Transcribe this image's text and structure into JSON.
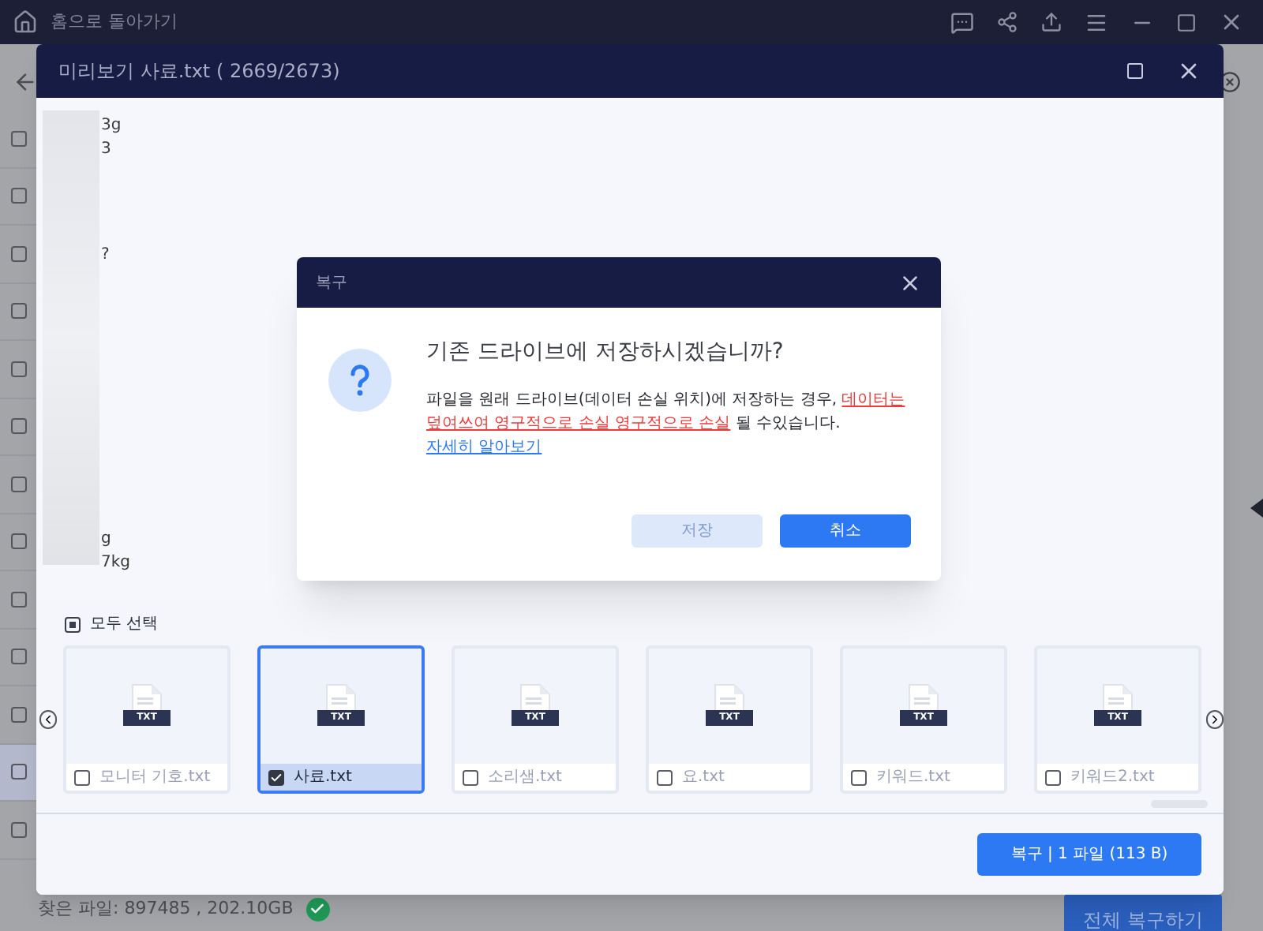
{
  "app_bar": {
    "title": "홈으로 돌아가기"
  },
  "file_list": {
    "rows": [
      {
        "checked": false,
        "selected": false
      },
      {
        "checked": false,
        "selected": false
      },
      {
        "checked": false,
        "selected": false
      },
      {
        "checked": false,
        "selected": false
      },
      {
        "checked": false,
        "selected": false
      },
      {
        "checked": false,
        "selected": false
      },
      {
        "checked": false,
        "selected": false
      },
      {
        "checked": false,
        "selected": false
      },
      {
        "checked": false,
        "selected": false
      },
      {
        "checked": false,
        "selected": false
      },
      {
        "checked": false,
        "selected": false
      },
      {
        "checked": false,
        "selected": true
      },
      {
        "checked": false,
        "selected": false
      }
    ]
  },
  "status": {
    "found": "찾은 파일: 897485 , 202.10GB",
    "recover_all": "전체 복구하기"
  },
  "preview": {
    "title": "미리보기 사료.txt ( 2669/2673)",
    "lines": [
      "3g",
      "3",
      "?",
      "g",
      "7kg"
    ],
    "select_all": {
      "label": "모두 선택",
      "indeterminate": true
    },
    "files": [
      {
        "name": "모니터 기호.txt",
        "badge": "TXT",
        "checked": false,
        "selected": false
      },
      {
        "name": "사료.txt",
        "badge": "TXT",
        "checked": true,
        "selected": true
      },
      {
        "name": "소리샘.txt",
        "badge": "TXT",
        "checked": false,
        "selected": false
      },
      {
        "name": "요.txt",
        "badge": "TXT",
        "checked": false,
        "selected": false
      },
      {
        "name": "키워드.txt",
        "badge": "TXT",
        "checked": false,
        "selected": false
      },
      {
        "name": "키워드2.txt",
        "badge": "TXT",
        "checked": false,
        "selected": false
      }
    ],
    "recover_button": "복구 | 1 파일 (113 B)"
  },
  "dialog": {
    "title": "복구",
    "heading": "기존 드라이브에 저장하시겠습니까?",
    "message": "파일을 원래 드라이브(데이터 손실 위치)에 저장하는 경우, **데이터는 덮여쓰여 영구적으로 손실 영구적으로 손실** 될 수있습니다.",
    "link": "자세히 알아보기",
    "buttons": [
      {
        "label": "저장",
        "kind": "secondary"
      },
      {
        "label": "취소",
        "kind": "primary"
      }
    ]
  }
}
